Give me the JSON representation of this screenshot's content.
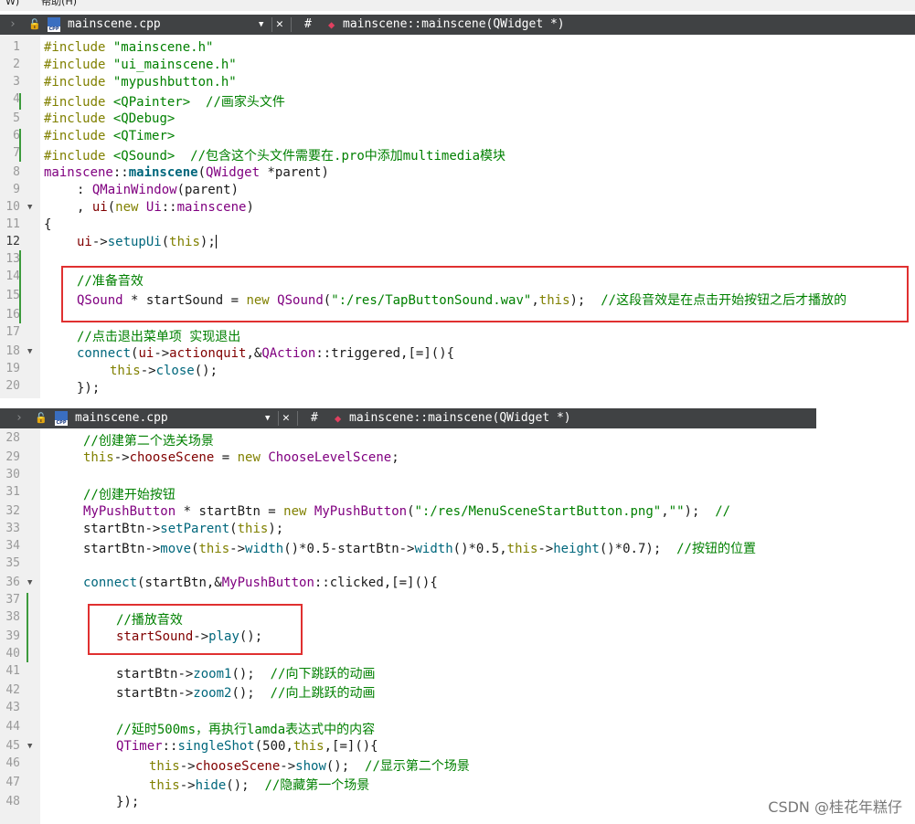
{
  "menubar": {
    "items": [
      "W)",
      "帮助(H)"
    ]
  },
  "editors": [
    {
      "toolbar": {
        "filename": "mainscene.cpp",
        "function_hash": "#",
        "function": "mainscene::mainscene(QWidget *)",
        "close_glyph": "✕"
      },
      "lines": [
        {
          "n": "1"
        },
        {
          "n": "2"
        },
        {
          "n": "3"
        },
        {
          "n": "4"
        },
        {
          "n": "5"
        },
        {
          "n": "6"
        },
        {
          "n": "7"
        },
        {
          "n": "8"
        },
        {
          "n": "9"
        },
        {
          "n": "10"
        },
        {
          "n": "11"
        },
        {
          "n": "12"
        },
        {
          "n": "13"
        },
        {
          "n": "14"
        },
        {
          "n": "15"
        },
        {
          "n": "16"
        },
        {
          "n": "17"
        },
        {
          "n": "18"
        },
        {
          "n": "19"
        },
        {
          "n": "20"
        }
      ],
      "code": {
        "l1": "#include",
        "l1s": "\"mainscene.h\"",
        "l2": "#include",
        "l2s": "\"ui_mainscene.h\"",
        "l3": "#include",
        "l3s": "\"mypushbutton.h\"",
        "l4": "#include",
        "l4s": "<QPainter>",
        "l4c": "//画家头文件",
        "l5": "#include",
        "l5s": "<QDebug>",
        "l6": "#include",
        "l6s": "<QTimer>",
        "l7": "#include",
        "l7s": "<QSound>",
        "l7c": "//包含这个头文件需要在.pro中添加multimedia模块",
        "l8a": "mainscene",
        "l8b": "::",
        "l8c": "mainscene",
        "l8d": "(",
        "l8e": "QWidget",
        "l8f": " *",
        "l8g": "parent",
        "l8h": ")",
        "l9a": ": ",
        "l9b": "QMainWindow",
        "l9c": "(parent)",
        "l10a": ", ",
        "l10b": "ui",
        "l10c": "(",
        "l10d": "new",
        "l10e": " ",
        "l10f": "Ui",
        "l10g": "::",
        "l10h": "mainscene",
        "l10i": ")",
        "l11": "{",
        "l12a": "ui",
        "l12b": "->",
        "l12c": "setupUi",
        "l12d": "(",
        "l12e": "this",
        "l12f": ");",
        "l14": "//准备音效",
        "l15a": "QSound",
        "l15b": " * startSound = ",
        "l15c": "new",
        "l15d": " ",
        "l15e": "QSound",
        "l15f": "(",
        "l15g": "\":/res/TapButtonSound.wav\"",
        "l15h": ",",
        "l15i": "this",
        "l15j": ");",
        "l15k": "//这段音效是在点击开始按钮之后才播放的",
        "l17": "//点击退出菜单项 实现退出",
        "l18a": "connect",
        "l18b": "(",
        "l18c": "ui",
        "l18d": "->",
        "l18e": "actionquit",
        "l18f": ",&",
        "l18g": "QAction",
        "l18h": "::triggered,[=](){",
        "l19a": "this",
        "l19b": "->",
        "l19c": "close",
        "l19d": "();",
        "l20": "});"
      }
    },
    {
      "toolbar": {
        "filename": "mainscene.cpp",
        "function_hash": "#",
        "function": "mainscene::mainscene(QWidget *)",
        "close_glyph": "✕"
      },
      "lines": [
        {
          "n": "28"
        },
        {
          "n": "29"
        },
        {
          "n": "30"
        },
        {
          "n": "31"
        },
        {
          "n": "32"
        },
        {
          "n": "33"
        },
        {
          "n": "34"
        },
        {
          "n": "35"
        },
        {
          "n": "36"
        },
        {
          "n": "37"
        },
        {
          "n": "38"
        },
        {
          "n": "39"
        },
        {
          "n": "40"
        },
        {
          "n": "41"
        },
        {
          "n": "42"
        },
        {
          "n": "43"
        },
        {
          "n": "44"
        },
        {
          "n": "45"
        },
        {
          "n": "46"
        },
        {
          "n": "47"
        },
        {
          "n": "48"
        }
      ],
      "code": {
        "l28": "//创建第二个选关场景",
        "l29a": "this",
        "l29b": "->",
        "l29c": "chooseScene",
        "l29d": " = ",
        "l29e": "new",
        "l29f": " ",
        "l29g": "ChooseLevelScene",
        "l29h": ";",
        "l31": "//创建开始按钮",
        "l32a": "MyPushButton",
        "l32b": " * startBtn = ",
        "l32c": "new",
        "l32d": " ",
        "l32e": "MyPushButton",
        "l32f": "(",
        "l32g": "\":/res/MenuSceneStartButton.png\"",
        "l32h": ",",
        "l32i": "\"\"",
        "l32j": ");",
        "l32k": "//",
        "l33a": "startBtn",
        "l33b": "->",
        "l33c": "setParent",
        "l33d": "(",
        "l33e": "this",
        "l33f": ");",
        "l34a": "startBtn",
        "l34b": "->",
        "l34c": "move",
        "l34d": "(",
        "l34e": "this",
        "l34f": "->",
        "l34g": "width",
        "l34h": "()*0.5-startBtn->",
        "l34i": "width",
        "l34j": "()*0.5,",
        "l34k": "this",
        "l34l": "->",
        "l34m": "height",
        "l34n": "()*0.7);",
        "l34o": "//按钮的位置",
        "l36a": "connect",
        "l36b": "(startBtn,&",
        "l36c": "MyPushButton",
        "l36d": "::clicked,[=](){",
        "l38": "//播放音效",
        "l39a": "startSound",
        "l39b": "->",
        "l39c": "play",
        "l39d": "();",
        "l41a": "startBtn",
        "l41b": "->",
        "l41c": "zoom1",
        "l41d": "();",
        "l41e": "//向下跳跃的动画",
        "l42a": "startBtn",
        "l42b": "->",
        "l42c": "zoom2",
        "l42d": "();",
        "l42e": "//向上跳跃的动画",
        "l44": "//延时500ms，再执行lamda表达式中的内容",
        "l45a": "QTimer",
        "l45b": "::",
        "l45c": "singleShot",
        "l45d": "(500,",
        "l45e": "this",
        "l45f": ",[=](){",
        "l46a": "this",
        "l46b": "->",
        "l46c": "chooseScene",
        "l46d": "->",
        "l46e": "show",
        "l46f": "();",
        "l46g": "//显示第二个场景",
        "l47a": "this",
        "l47b": "->",
        "l47c": "hide",
        "l47d": "();",
        "l47e": "//隐藏第一个场景",
        "l48": "});"
      }
    }
  ],
  "watermark": "CSDN @桂花年糕仔",
  "colors": {
    "toolbar_bg": "#404244",
    "gutter_bg": "#f0f0f0",
    "highlight_box": "#e03030",
    "change_bar": "#3c9a3c"
  }
}
